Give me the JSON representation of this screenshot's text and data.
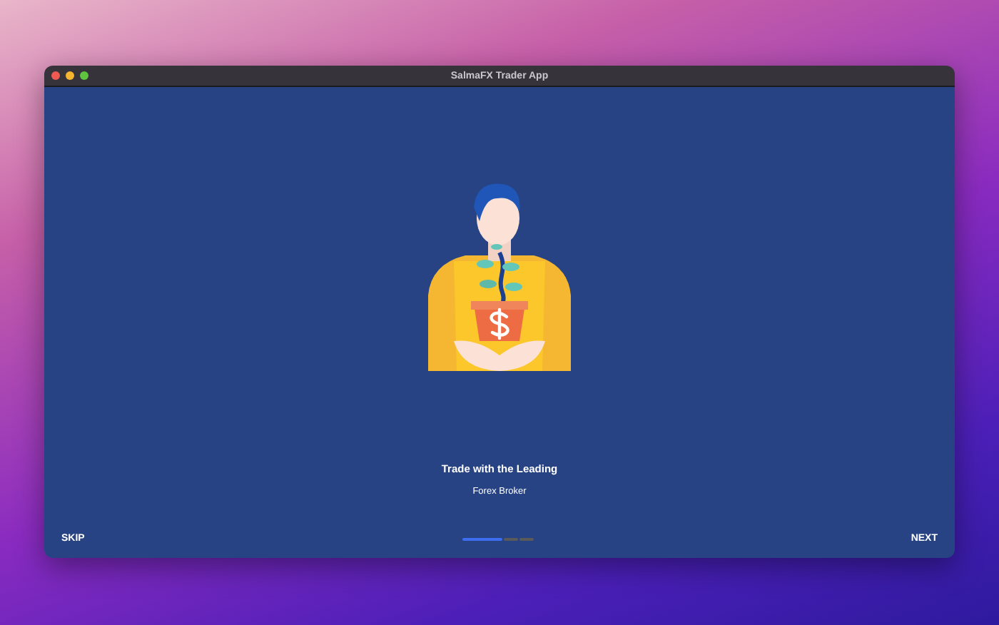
{
  "window": {
    "title": "SalmaFX Trader App"
  },
  "onboarding": {
    "title": "Trade with the Leading",
    "subtitle": "Forex Broker"
  },
  "pages": [
    {
      "selected": true
    },
    {
      "selected": false
    },
    {
      "selected": false
    }
  ],
  "buttons": {
    "skip": "SKIP",
    "next": "NEXT"
  }
}
